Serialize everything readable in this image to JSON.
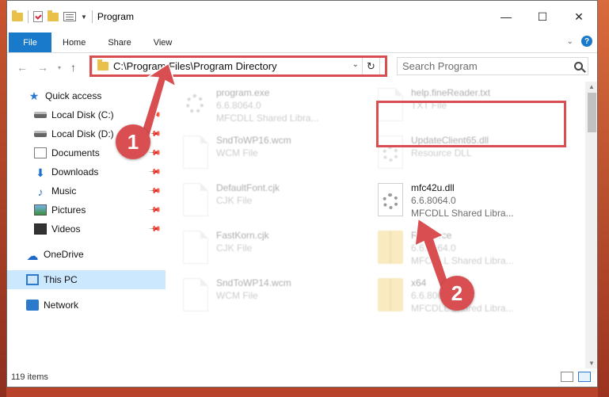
{
  "window": {
    "title": "Program",
    "minimize": "—",
    "maximize": "☐",
    "close": "✕"
  },
  "ribbon": {
    "tabs": [
      "File",
      "Home",
      "Share",
      "View"
    ]
  },
  "address": {
    "path": "C:\\Program Files\\Program Directory"
  },
  "search": {
    "placeholder": "Search Program"
  },
  "sidebar": {
    "items": [
      {
        "label": "Quick access",
        "icon": "star-icon"
      },
      {
        "label": "Local Disk (C:)",
        "icon": "disk-icon"
      },
      {
        "label": "Local Disk (D:)",
        "icon": "disk-icon"
      },
      {
        "label": "Documents",
        "icon": "documents-icon"
      },
      {
        "label": "Downloads",
        "icon": "downloads-icon"
      },
      {
        "label": "Music",
        "icon": "music-icon"
      },
      {
        "label": "Pictures",
        "icon": "pictures-icon"
      },
      {
        "label": "Videos",
        "icon": "videos-icon"
      },
      {
        "label": "OneDrive",
        "icon": "cloud-icon"
      },
      {
        "label": "This PC",
        "icon": "computer-icon"
      },
      {
        "label": "Network",
        "icon": "network-icon"
      }
    ]
  },
  "files": [
    {
      "name": "program.exe",
      "line2": "6.6.8064.0",
      "line3": "MFCDLL Shared Libra..."
    },
    {
      "name": "help.fineReader.txt",
      "line2": "TXT File",
      "line3": ""
    },
    {
      "name": "SndToWP16.wcm",
      "line2": "WCM File",
      "line3": ""
    },
    {
      "name": "UpdateClient65.dll",
      "line2": "Resource DLL",
      "line3": ""
    },
    {
      "name": "DefaultFont.cjk",
      "line2": "CJK File",
      "line3": ""
    },
    {
      "name": "mfc42u.dll",
      "line2": "6.6.8064.0",
      "line3": "MFCDLL Shared Libra..."
    },
    {
      "name": "FastKorn.cjk",
      "line2": "CJK File",
      "line3": ""
    },
    {
      "name": "Resource",
      "line2": "6.6.8064.0",
      "line3": "MFCDLL Shared Libra..."
    },
    {
      "name": "SndToWP14.wcm",
      "line2": "WCM File",
      "line3": ""
    },
    {
      "name": "x64",
      "line2": "6.6.8064.0",
      "line3": "MFCDLL Shared Libra..."
    }
  ],
  "status": {
    "count": "119 items"
  },
  "callouts": [
    "1",
    "2"
  ],
  "colors": {
    "accent": "#1979ca",
    "annotation": "#d94e50",
    "selection": "#cce8ff"
  }
}
